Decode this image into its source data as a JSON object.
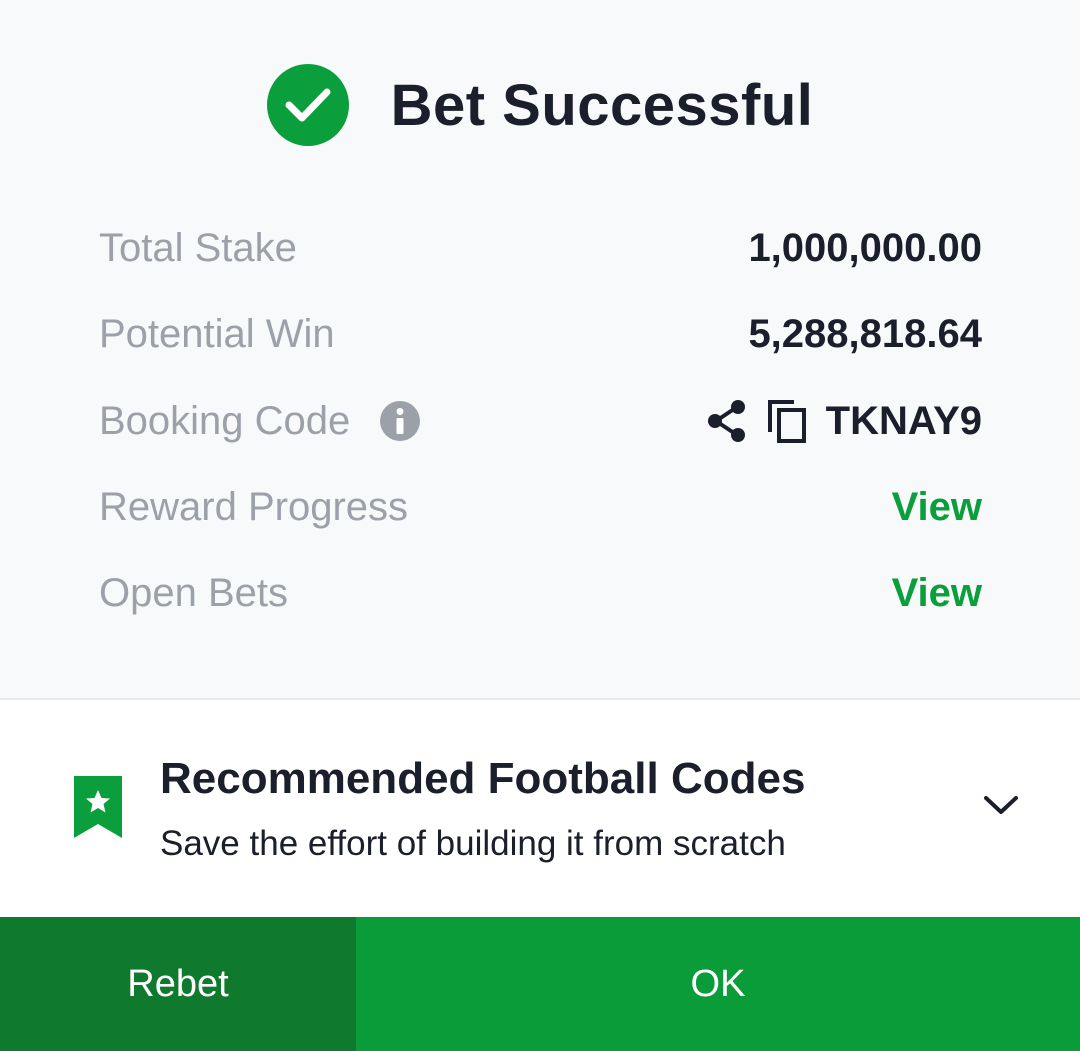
{
  "header": {
    "title": "Bet Successful",
    "icon": "check-circle-icon",
    "accent": "#0b9e3c"
  },
  "details": {
    "total_stake": {
      "label": "Total Stake",
      "value": "1,000,000.00"
    },
    "potential_win": {
      "label": "Potential Win",
      "value": "5,288,818.64"
    },
    "booking_code": {
      "label": "Booking Code",
      "value": "TKNAY9",
      "icons": [
        "info-icon",
        "share-icon",
        "copy-icon"
      ]
    },
    "reward_progress": {
      "label": "Reward Progress",
      "link": "View"
    },
    "open_bets": {
      "label": "Open Bets",
      "link": "View"
    }
  },
  "recommended": {
    "title": "Recommended Football Codes",
    "subtitle": "Save the effort of building it from scratch",
    "icon": "bookmark-star-icon",
    "toggle_icon": "chevron-down-icon"
  },
  "footer": {
    "rebet_label": "Rebet",
    "ok_label": "OK"
  }
}
